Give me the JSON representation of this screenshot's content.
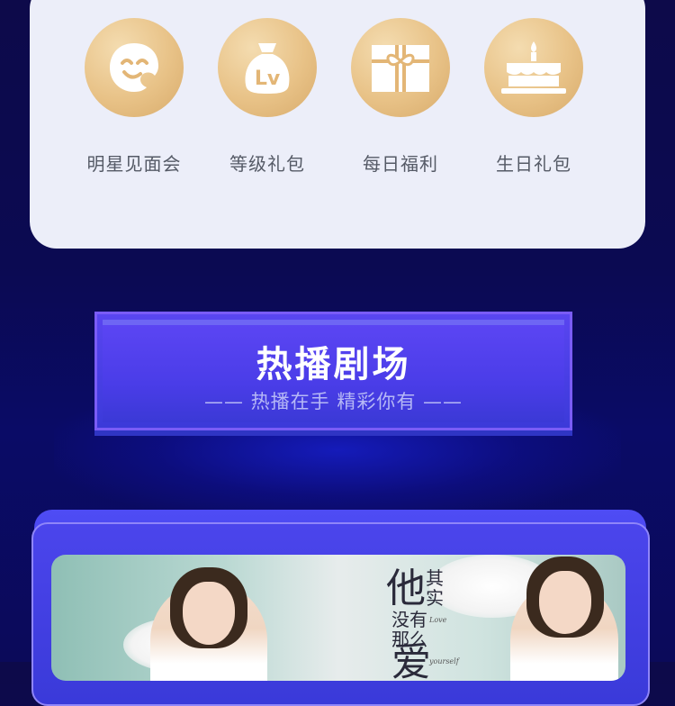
{
  "benefits": [
    {
      "label": "明星见面会",
      "icon": "smile-face-icon"
    },
    {
      "label": "等级礼包",
      "icon": "level-bag-icon",
      "badge": "Lv"
    },
    {
      "label": "每日福利",
      "icon": "gift-box-icon"
    },
    {
      "label": "生日礼包",
      "icon": "birthday-cake-icon"
    }
  ],
  "section": {
    "title": "热播剧场",
    "subtitle": "—— 热播在手  精彩你有 ——"
  },
  "poster": {
    "title_chars": [
      "他",
      "其",
      "实",
      "没有",
      "那么",
      "爱"
    ],
    "english_words": [
      "Love",
      "yourself"
    ]
  },
  "colors": {
    "background": "#0b0a52",
    "card": "#eceef9",
    "gold": "#e8c287",
    "banner": "#4a3fe6",
    "label_text": "#555a66"
  }
}
